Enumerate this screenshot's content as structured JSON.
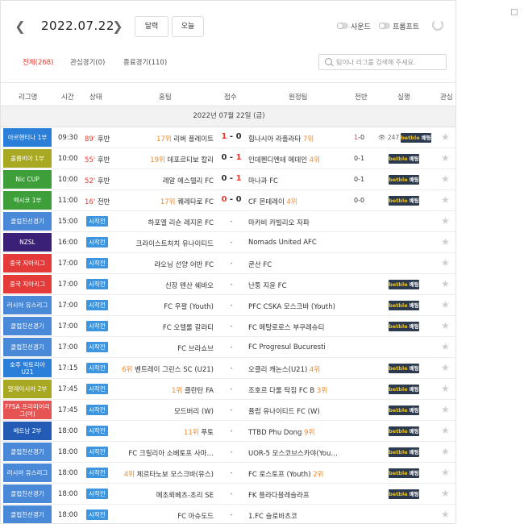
{
  "topbar": {
    "date": "2022.07.22",
    "calendar_btn": "달력",
    "today_btn": "오늘",
    "sound_label": "사운드",
    "prompt_label": "프롬프트",
    "prev_icon": "chevron-left-icon",
    "next_icon": "chevron-right-icon",
    "refresh_icon": "refresh-icon"
  },
  "filters": {
    "all": "전체(268)",
    "interest": "관심경기(0)",
    "finished": "종료경기(110)",
    "search_placeholder": "팀이나 리그를 검색해 주세요."
  },
  "columns": {
    "league": "리그명",
    "time": "시간",
    "status": "상태",
    "home": "홈팀",
    "score": "점수",
    "away": "원정팀",
    "half": "전반",
    "live": "실행",
    "fav": "관심"
  },
  "day_label": "2022년 07월 22일 (금)",
  "colors": {
    "accent_red": "#e83a2f",
    "rank_orange": "#f18a2a",
    "start_blue": "#3d95e0",
    "bet_dark": "#2c3a4f"
  },
  "rows": [
    {
      "league": "아르헨티나 1부",
      "league_color": "#2c7fd8",
      "time": "09:30",
      "minute": "89'",
      "phase": "후반",
      "home": "리버 플레이트",
      "home_rank": "17위",
      "score_home": "1",
      "score_away": "0",
      "away": "힘나시아 라플라타",
      "away_rank": "7위",
      "half_a": "1",
      "half_b": "0",
      "viewers": "247",
      "bet": true
    },
    {
      "league": "콜롬비아 1부",
      "league_color": "#a8a823",
      "time": "10:00",
      "minute": "55'",
      "phase": "후반",
      "home": "데포르티보 칼리",
      "home_rank": "19위",
      "score_home": "0",
      "score_away": "1",
      "away": "인데펜디엔테 메데인",
      "away_rank": "4위",
      "half_a": "0",
      "half_b": "1",
      "viewers": "",
      "bet": true
    },
    {
      "league": "Nic CUP",
      "league_color": "#3e9e3a",
      "time": "10:00",
      "minute": "52'",
      "phase": "후반",
      "home": "레알 에스텔리 FC",
      "home_rank": "",
      "score_home": "0",
      "score_away": "1",
      "away": "마나과 FC",
      "away_rank": "",
      "half_a": "0",
      "half_b": "1",
      "viewers": "",
      "bet": true
    },
    {
      "league": "멕시코 1부",
      "league_color": "#3e9e3a",
      "time": "11:00",
      "minute": "16'",
      "phase": "전반",
      "home": "퀘레타로 FC",
      "home_rank": "17위",
      "score_home": "0",
      "score_away": "0",
      "away": "CF 몬테레이",
      "away_rank": "4위",
      "half_a": "0",
      "half_b": "0",
      "viewers": "",
      "bet": true
    },
    {
      "league": "클럽친선경기",
      "league_color": "#4a88d8",
      "time": "15:00",
      "start": "시작전",
      "home": "하포엘 리숀 레지온 FC",
      "home_rank": "",
      "away": "마카비 카빌리오 자파",
      "away_rank": "",
      "bet": false
    },
    {
      "league": "NZSL",
      "league_color": "#3b2078",
      "time": "16:00",
      "start": "시작전",
      "home": "크라이스트처치 유나이티드",
      "home_rank": "",
      "away": "Nomads United AFC",
      "away_rank": "",
      "bet": false
    },
    {
      "league": "중국 지아리그",
      "league_color": "#e53a3a",
      "time": "17:00",
      "start": "시작전",
      "home": "랴오닝 선양 어반 FC",
      "home_rank": "",
      "away": "쿤산 FC",
      "away_rank": "",
      "bet": false
    },
    {
      "league": "중국 지아리그",
      "league_color": "#e53a3a",
      "time": "17:00",
      "start": "시작전",
      "home": "신장 톈산 쉐바오",
      "home_rank": "",
      "away": "난퉁 지윤 FC",
      "away_rank": "",
      "bet": true
    },
    {
      "league": "러시아 유스리그",
      "league_color": "#4a88d8",
      "time": "17:00",
      "start": "시작전",
      "home": "FC 우팔 (Youth)",
      "home_rank": "",
      "away": "PFC CSKA 모스크바 (Youth)",
      "away_rank": "",
      "bet": true
    },
    {
      "league": "클럽친선경기",
      "league_color": "#4a88d8",
      "time": "17:00",
      "start": "시작전",
      "home": "FC 오텔룰 갈라티",
      "home_rank": "",
      "away": "FC 메탈로로스 부쿠레슈티",
      "away_rank": "",
      "bet": true
    },
    {
      "league": "클럽친선경기",
      "league_color": "#4a88d8",
      "time": "17:00",
      "start": "시작전",
      "home": "FC 브라쇼브",
      "home_rank": "",
      "away": "FC Progresul Bucuresti",
      "away_rank": "",
      "bet": false
    },
    {
      "league": "호주 빅토리아U21",
      "league_color": "#2c7fd8",
      "time": "17:15",
      "start": "시작전",
      "home": "벤트레이 그린스 SC (U21)",
      "home_rank": "6위",
      "away": "오클리 캐논스(U21)",
      "away_rank": "4위",
      "bet": true
    },
    {
      "league": "말레이시아 2부",
      "league_color": "#a8a823",
      "time": "17:45",
      "start": "시작전",
      "home": "클란탄 FA",
      "home_rank": "1위",
      "away": "조호르 다룰 탁짐 FC B",
      "away_rank": "3위",
      "bet": true
    },
    {
      "league": "FFSA 프리미어리그(여)",
      "league_color": "#e55353",
      "time": "17:45",
      "start": "시작전",
      "home": "모드버리 (W)",
      "home_rank": "",
      "away": "퓰럼 유나이티드 FC (W)",
      "away_rank": "",
      "bet": true
    },
    {
      "league": "베트남 2부",
      "league_color": "#235bb5",
      "time": "18:00",
      "start": "시작전",
      "home": "푸토",
      "home_rank": "11위",
      "away": "TTBD Phu Dong",
      "away_rank": "9위",
      "bet": true
    },
    {
      "league": "클럽친선경기",
      "league_color": "#4a88d8",
      "time": "18:00",
      "start": "시작전",
      "home": "FC 크릴리아 소베토프 사마…",
      "home_rank": "",
      "away": "UOR-5 모스코브스카야(You…",
      "away_rank": "",
      "bet": true
    },
    {
      "league": "러시아 유스리그",
      "league_color": "#4a88d8",
      "time": "18:00",
      "start": "시작전",
      "home": "체르타노보 모스크바(유스)",
      "home_rank": "4위",
      "away": "FC 로스토프 (Youth)",
      "away_rank": "2위",
      "bet": true
    },
    {
      "league": "클럽친선경기",
      "league_color": "#4a88d8",
      "time": "18:00",
      "start": "시작전",
      "home": "메초뢰베츠-초리 SE",
      "home_rank": "",
      "away": "FK 플라다블레슬라프",
      "away_rank": "",
      "bet": true
    },
    {
      "league": "클럽친선경기",
      "league_color": "#4a88d8",
      "time": "18:00",
      "start": "시작전",
      "home": "FC 아슈도드",
      "home_rank": "",
      "away": "1.FC 슬로바츠코",
      "away_rank": "",
      "bet": false
    }
  ],
  "bet_logo": {
    "brand": "betble",
    "suffix": "배팅"
  },
  "icons": {
    "star": "star-icon",
    "viewers": "eye-icon"
  }
}
